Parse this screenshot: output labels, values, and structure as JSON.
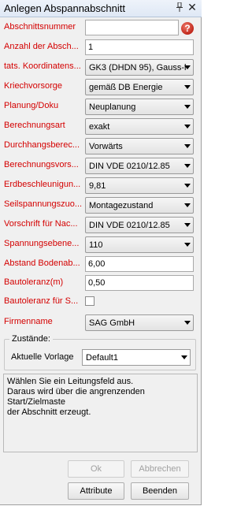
{
  "window": {
    "title": "Anlegen Abspannabschnitt",
    "pin_glyph": "↕",
    "close_glyph": "✕"
  },
  "fields": [
    {
      "label": "Abschnittsnummer",
      "type": "input",
      "value": "",
      "help": "?"
    },
    {
      "label": "Anzahl der Absch...",
      "type": "input",
      "value": "1"
    },
    {
      "label": "tats. Koordinatens...",
      "type": "select",
      "value": "GK3 (DHDN 95), Gauss-l"
    },
    {
      "label": "Kriechvorsorge",
      "type": "select",
      "value": "gemäß DB Energie"
    },
    {
      "label": "Planung/Doku",
      "type": "select",
      "value": "Neuplanung"
    },
    {
      "label": "Berechnungsart",
      "type": "select",
      "value": "exakt"
    },
    {
      "label": "Durchhangsberec...",
      "type": "select",
      "value": "Vorwärts"
    },
    {
      "label": "Berechnungsvors...",
      "type": "select",
      "value": "DIN VDE 0210/12.85"
    },
    {
      "label": "Erdbeschleunigun...",
      "type": "select",
      "value": "9,81"
    },
    {
      "label": "Seilspannungszuo...",
      "type": "select",
      "value": "Montagezustand"
    },
    {
      "label": "Vorschrift für Nac...",
      "type": "select",
      "value": "DIN VDE 0210/12.85"
    },
    {
      "label": "Spannungsebene...",
      "type": "select",
      "value": "110"
    },
    {
      "label": "Abstand Bodenab...",
      "type": "input",
      "value": "6,00"
    },
    {
      "label": "Bautoleranz(m)",
      "type": "input",
      "value": "0,50"
    },
    {
      "label": "Bautoleranz für S...",
      "type": "checkbox",
      "checked": false
    },
    {
      "label": "Firmenname",
      "type": "select",
      "value": "SAG GmbH"
    }
  ],
  "zustaende": {
    "title": "Zustände:",
    "label": "Aktuelle Vorlage",
    "value": "Default1"
  },
  "info_lines": [
    "Wählen Sie ein Leitungsfeld aus.",
    "Daraus wird über die angrenzenden",
    "Start/Zielmaste",
    "der Abschnitt erzeugt."
  ],
  "buttons": {
    "ok": "Ok",
    "cancel": "Abbrechen",
    "attribute": "Attribute",
    "finish": "Beenden"
  },
  "colors": {
    "label_red": "#d40000",
    "help_red": "#c0271b"
  }
}
